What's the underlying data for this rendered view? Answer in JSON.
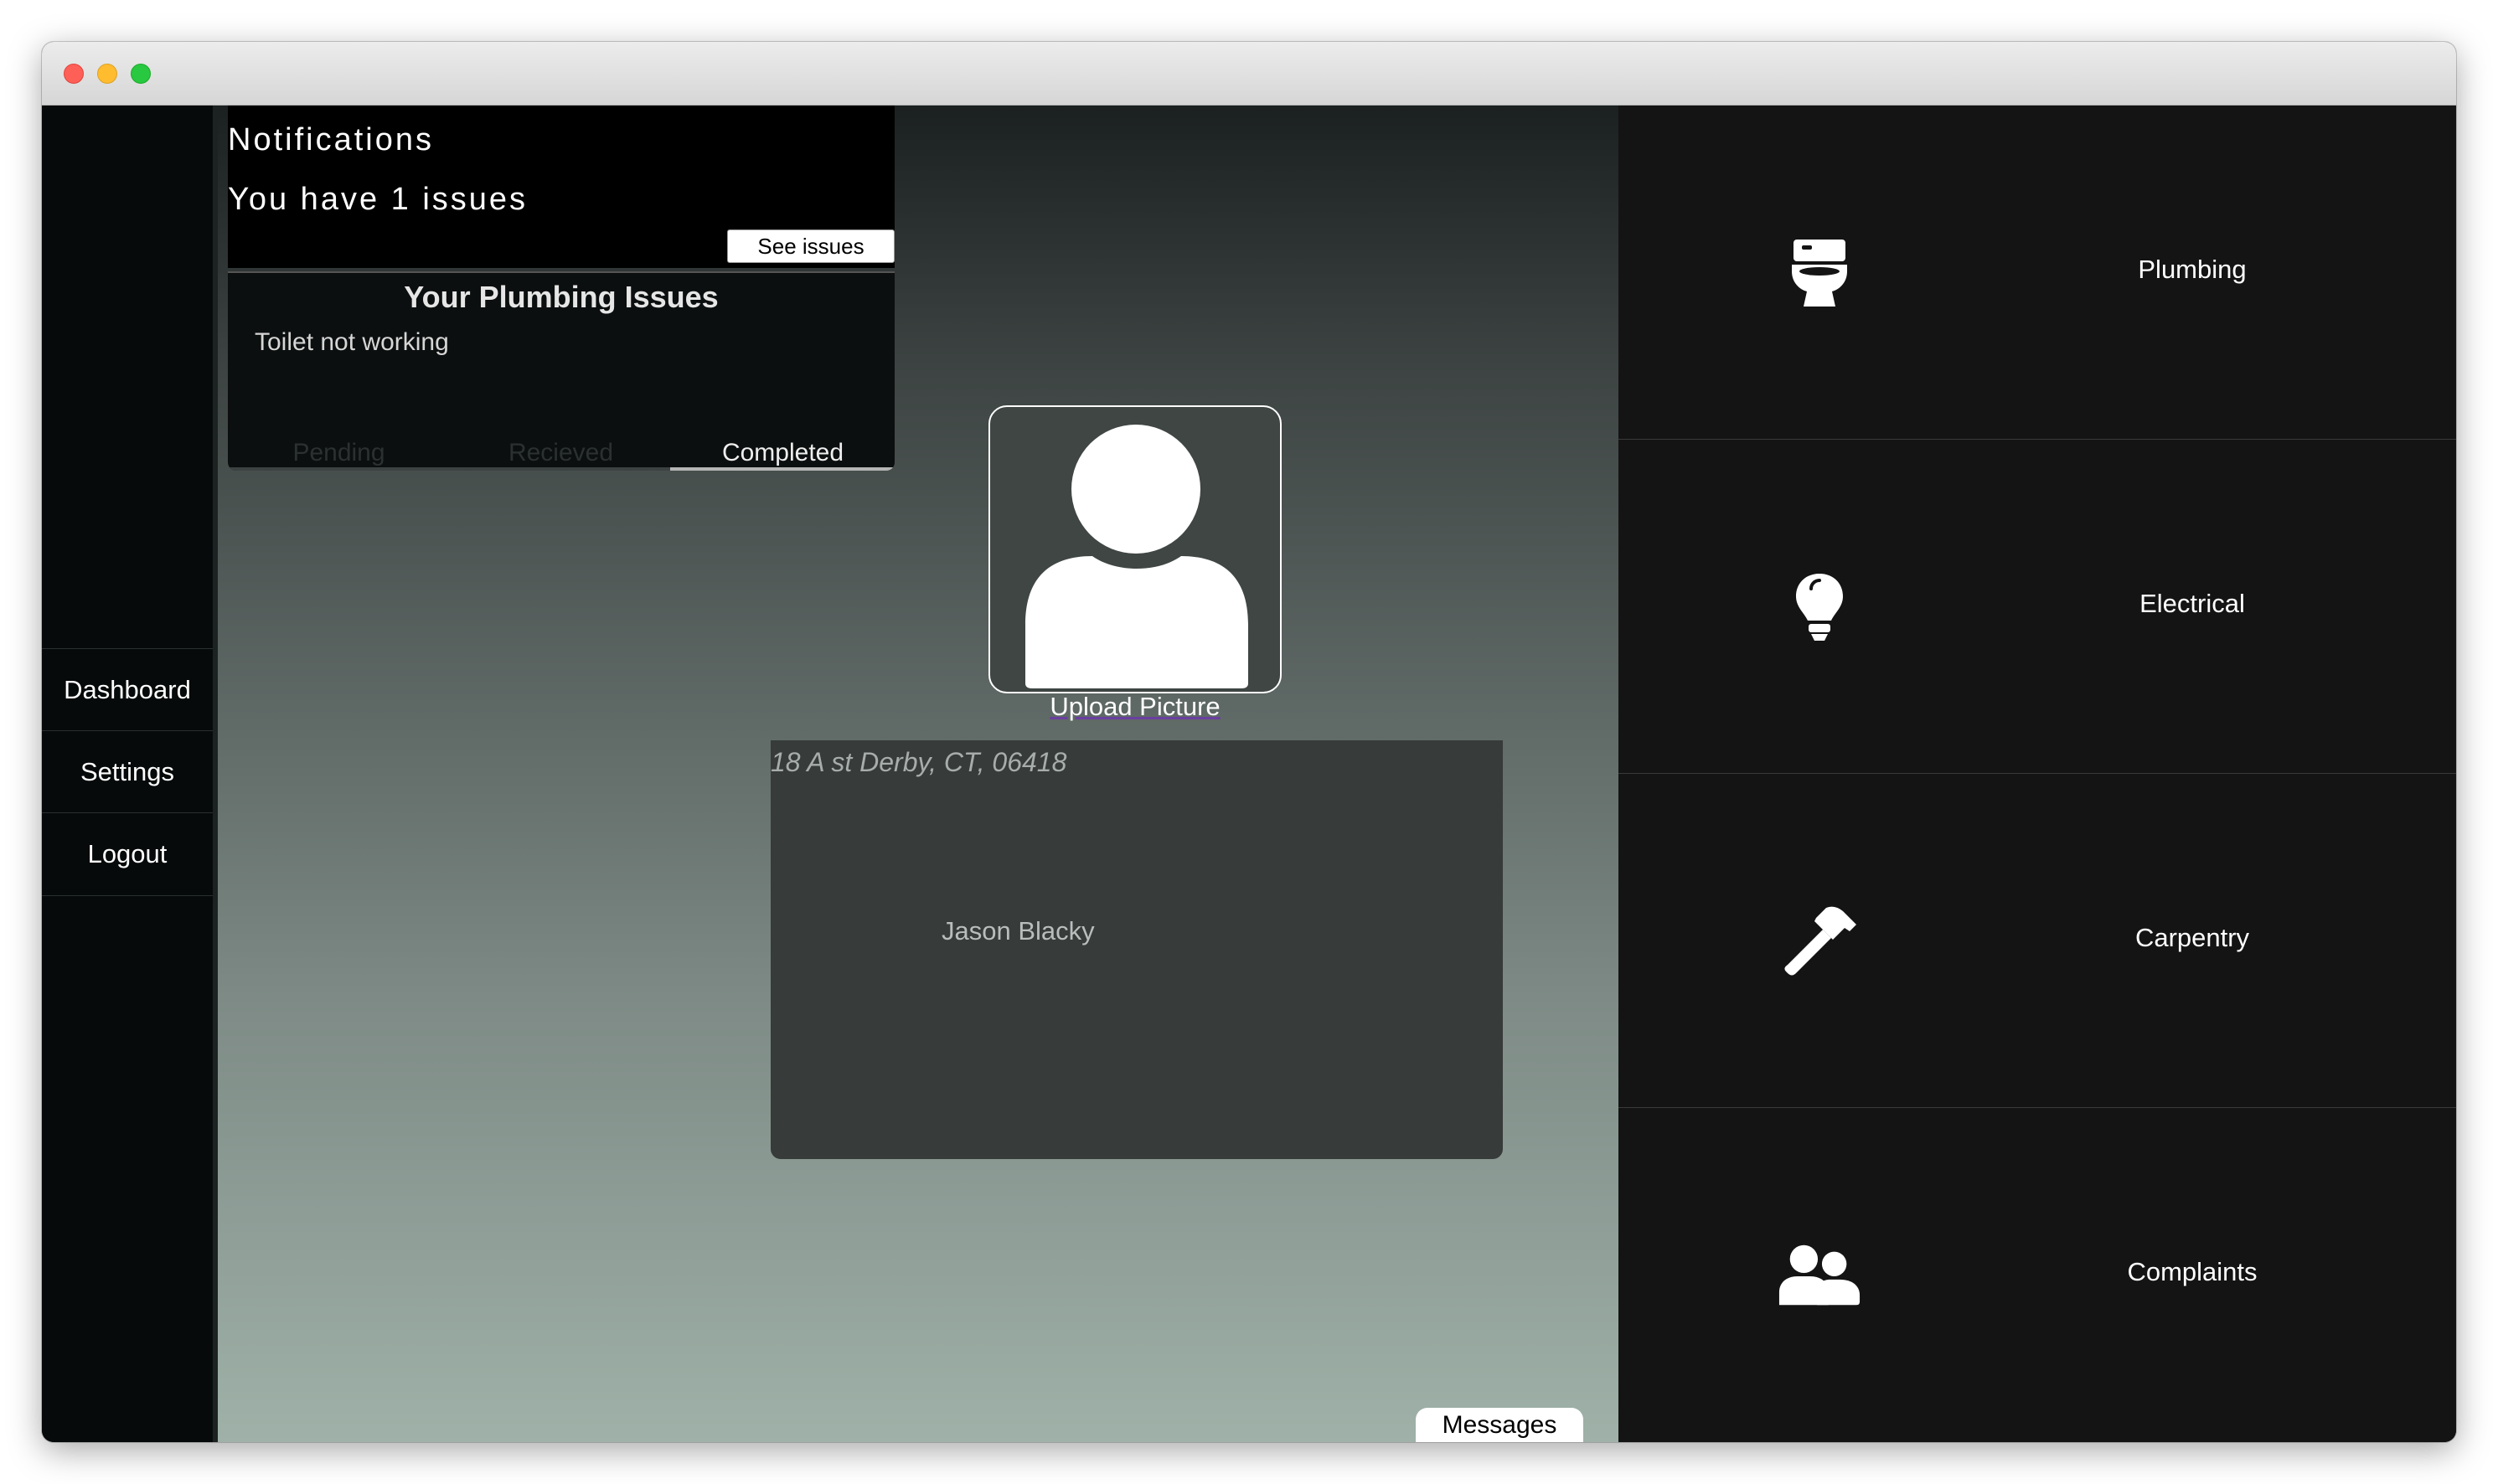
{
  "window": {
    "traffic_lights": [
      "close",
      "minimize",
      "maximize"
    ]
  },
  "sidebar": {
    "items": [
      {
        "label": "Dashboard"
      },
      {
        "label": "Settings"
      },
      {
        "label": "Logout"
      }
    ]
  },
  "notifications": {
    "title": "Notifications",
    "count_text": "You have 1 issues",
    "button_label": "See issues"
  },
  "issues": {
    "title": "Your Plumbing Issues",
    "items": [
      "Toilet not working"
    ],
    "tabs": [
      {
        "label": "Pending",
        "active": false
      },
      {
        "label": "Recieved",
        "active": false
      },
      {
        "label": "Completed",
        "active": true
      }
    ]
  },
  "profile": {
    "upload_label": "Upload Picture",
    "address": "18 A st Derby, CT, 06418",
    "name": "Jason Blacky"
  },
  "messages": {
    "label": "Messages"
  },
  "categories": [
    {
      "label": "Plumbing",
      "icon": "toilet-icon"
    },
    {
      "label": "Electrical",
      "icon": "lightbulb-icon"
    },
    {
      "label": "Carpentry",
      "icon": "hammer-icon"
    },
    {
      "label": "Complaints",
      "icon": "users-icon"
    }
  ],
  "colors": {
    "sidebar_bg": "#060a0a",
    "category_bg": "#141414",
    "main_gradient_top": "#1b2020",
    "main_gradient_bottom": "#9fb1a8"
  }
}
